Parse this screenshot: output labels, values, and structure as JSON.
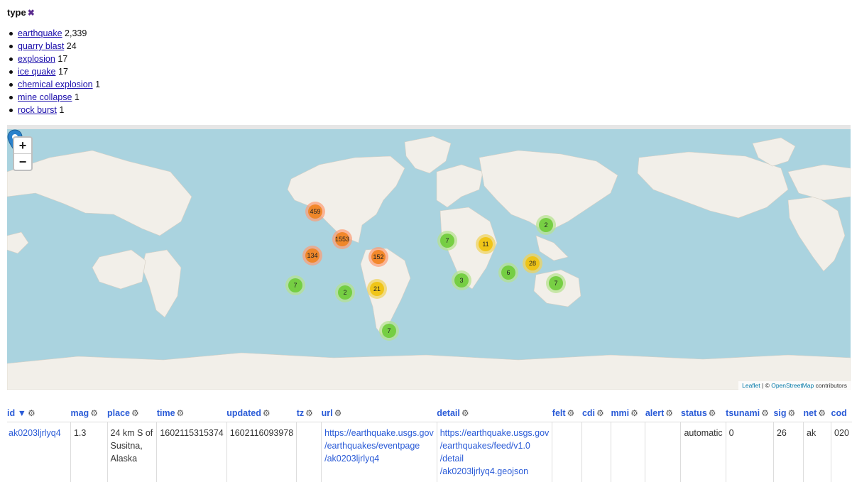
{
  "facet": {
    "title": "type",
    "remove_icon": "x-icon",
    "items": [
      {
        "label": "earthquake",
        "count": "2,339"
      },
      {
        "label": "quarry blast",
        "count": "24"
      },
      {
        "label": "explosion",
        "count": "17"
      },
      {
        "label": "ice quake",
        "count": "17"
      },
      {
        "label": "chemical explosion",
        "count": "1"
      },
      {
        "label": "mine collapse",
        "count": "1"
      },
      {
        "label": "rock burst",
        "count": "1"
      }
    ]
  },
  "map": {
    "zoom_in": "+",
    "zoom_out": "−",
    "clusters": [
      {
        "label": "459",
        "tier": "orange"
      },
      {
        "label": "1553",
        "tier": "orange"
      },
      {
        "label": "134",
        "tier": "orange"
      },
      {
        "label": "152",
        "tier": "orange"
      },
      {
        "label": "7",
        "tier": "green"
      },
      {
        "label": "2",
        "tier": "green"
      },
      {
        "label": "21",
        "tier": "yellow"
      },
      {
        "label": "7",
        "tier": "green"
      },
      {
        "label": "7",
        "tier": "green"
      },
      {
        "label": "11",
        "tier": "yellow"
      },
      {
        "label": "3",
        "tier": "green"
      },
      {
        "label": "6",
        "tier": "green"
      },
      {
        "label": "28",
        "tier": "yellow"
      },
      {
        "label": "2",
        "tier": "green"
      },
      {
        "label": "7",
        "tier": "green"
      }
    ],
    "colors": {
      "water": "#aad3df",
      "land": "#f2efe9",
      "green": "#6ecc39",
      "yellow": "#f0c20c",
      "orange": "#f18017"
    },
    "attribution": {
      "leaflet": "Leaflet",
      "separator": " | © ",
      "osm": "OpenStreetMap",
      "suffix": " contributors"
    }
  },
  "table": {
    "columns": [
      "id ▼",
      "mag",
      "place",
      "time",
      "updated",
      "tz",
      "url",
      "detail",
      "felt",
      "cdi",
      "mmi",
      "alert",
      "status",
      "tsunami",
      "sig",
      "net",
      "cod"
    ],
    "row": {
      "id": "ak0203ljrlyq4",
      "mag": "1.3",
      "place": [
        "24 km S of",
        "Susitna,",
        "Alaska"
      ],
      "time": "1602115315374",
      "updated": "1602116093978",
      "tz": "",
      "url": [
        "https://earthquake.usgs.gov",
        "/earthquakes/eventpage",
        "/ak0203ljrlyq4"
      ],
      "detail": [
        "https://earthquake.usgs.gov",
        "/earthquakes/feed/v1.0",
        "/detail",
        "/ak0203ljrlyq4.geojson"
      ],
      "felt": "",
      "cdi": "",
      "mmi": "",
      "alert": "",
      "status": "automatic",
      "tsunami": "0",
      "sig": "26",
      "net": "ak",
      "code": "020"
    }
  }
}
